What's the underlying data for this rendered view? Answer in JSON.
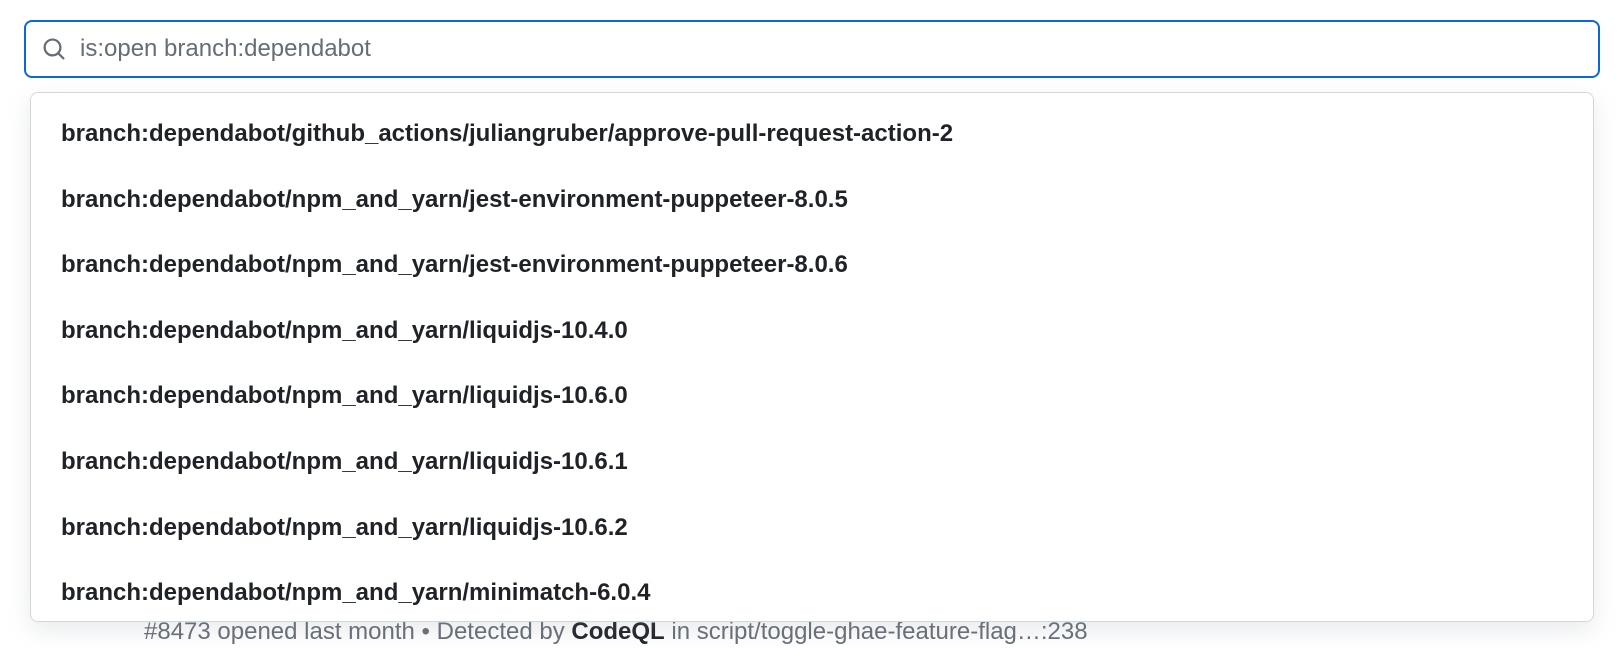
{
  "search": {
    "value": "is:open branch:dependabot",
    "placeholder": ""
  },
  "suggestions": [
    "branch:dependabot/github_actions/juliangruber/approve-pull-request-action-2",
    "branch:dependabot/npm_and_yarn/jest-environment-puppeteer-8.0.5",
    "branch:dependabot/npm_and_yarn/jest-environment-puppeteer-8.0.6",
    "branch:dependabot/npm_and_yarn/liquidjs-10.4.0",
    "branch:dependabot/npm_and_yarn/liquidjs-10.6.0",
    "branch:dependabot/npm_and_yarn/liquidjs-10.6.1",
    "branch:dependabot/npm_and_yarn/liquidjs-10.6.2",
    "branch:dependabot/npm_and_yarn/minimatch-6.0.4"
  ],
  "background_row": {
    "prefix": "#8473 opened last month • Detected by ",
    "tool": "CodeQL",
    "suffix": " in script/toggle-ghae-feature-flag…:238"
  }
}
